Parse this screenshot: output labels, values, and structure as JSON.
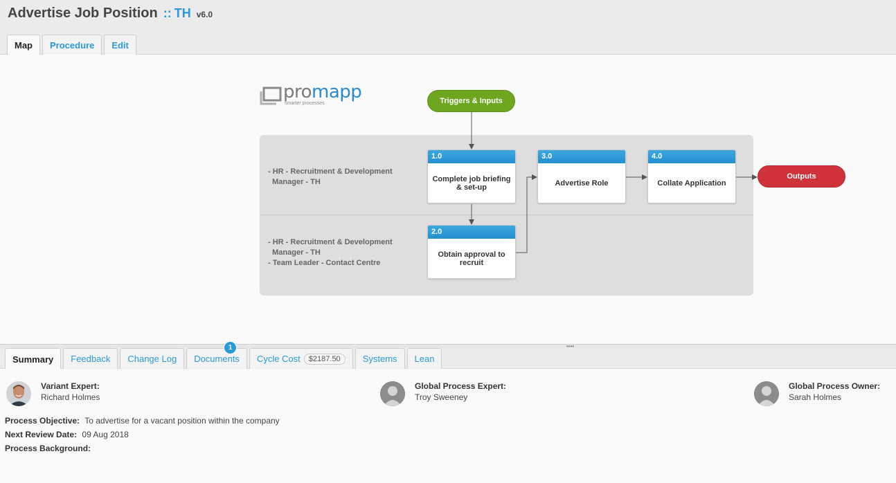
{
  "header": {
    "title": "Advertise Job Position",
    "separator": "::",
    "variant": "TH",
    "version": "v6.0"
  },
  "top_tabs": [
    {
      "label": "Map",
      "active": true
    },
    {
      "label": "Procedure",
      "active": false
    },
    {
      "label": "Edit",
      "active": false
    }
  ],
  "map": {
    "logo": {
      "pro": "pro",
      "mapp": "mapp",
      "tagline": "smarter processes"
    },
    "triggers": "Triggers & Inputs",
    "outputs": "Outputs",
    "lanes": [
      {
        "roles": [
          "- HR - Recruitment & Development",
          "  Manager - TH"
        ]
      },
      {
        "roles": [
          "- HR - Recruitment & Development",
          "  Manager - TH",
          "- Team Leader - Contact Centre"
        ]
      }
    ],
    "steps": [
      {
        "number": "1.0",
        "label": "Complete job briefing & set-up"
      },
      {
        "number": "2.0",
        "label": "Obtain approval to recruit"
      },
      {
        "number": "3.0",
        "label": "Advertise Role"
      },
      {
        "number": "4.0",
        "label": "Collate Application"
      }
    ],
    "colors": {
      "accent": "#2a9ad6",
      "triggers": "#6fa620",
      "outputs": "#d0323a",
      "lane_bg": "#dedede"
    }
  },
  "bottom_tabs": [
    {
      "label": "Summary",
      "active": true
    },
    {
      "label": "Feedback",
      "active": false
    },
    {
      "label": "Change Log",
      "active": false
    },
    {
      "label": "Documents",
      "active": false,
      "badge": "1"
    },
    {
      "label": "Cycle Cost",
      "active": false,
      "value": "$2187.50"
    },
    {
      "label": "Systems",
      "active": false
    },
    {
      "label": "Lean",
      "active": false
    }
  ],
  "summary": {
    "people": [
      {
        "role": "Variant Expert:",
        "name": "Richard Holmes",
        "avatar": "photo-avatar"
      },
      {
        "role": "Global Process Expert:",
        "name": "Troy Sweeney",
        "avatar": "default-user-icon"
      },
      {
        "role": "Global Process Owner:",
        "name": "Sarah Holmes",
        "avatar": "default-user-icon"
      }
    ],
    "objective_label": "Process Objective:",
    "objective": "To advertise for a vacant position within the company",
    "review_label": "Next Review Date:",
    "review_date": "09 Aug 2018",
    "background_label": "Process Background:",
    "background": ""
  }
}
